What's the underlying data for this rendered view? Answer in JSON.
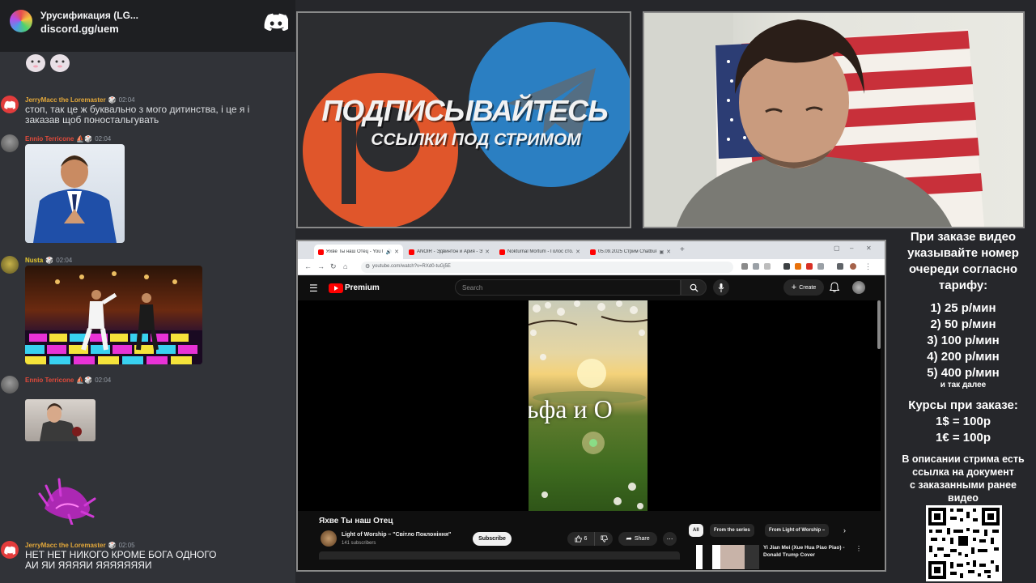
{
  "discord": {
    "server_name": "Урусификация (LG...",
    "invite": "discord.gg/uem",
    "messages": [
      {
        "author": "JerryMacc the Loremaster",
        "time": "02:04",
        "text_lines": [
          "стоп, так це ж буквально з мого дитинства, і це я і",
          "заказав щоб поностальгувать"
        ]
      },
      {
        "author": "Ennio Terricone",
        "time": "02:04",
        "attachment": "suit-man-image"
      },
      {
        "author": "Nusta",
        "time": "02:04",
        "attachment": "disco-dance-image"
      },
      {
        "author": "Ennio Terricone",
        "time": "02:04",
        "attachment": "man-photo"
      },
      {
        "author": "JerryMacc the Loremaster",
        "time": "02:05",
        "text_lines": [
          "НЕТ НЕТ НИКОГО КРОМЕ БОГА ОДНОГО",
          "АИ ЯИ ЯЯЯЯИ ЯЯЯЯЯЯЯИ"
        ]
      }
    ]
  },
  "promo": {
    "title": "ПОДПИСЫВАЙТЕСЬ",
    "subtitle": "ССЫЛКИ ПОД СТРИМОМ"
  },
  "browser": {
    "tabs": [
      {
        "title": "Яхве Ты наш Отец - YouTube",
        "active": true,
        "favicon_color": "#ff0000"
      },
      {
        "title": "ANOIR - Эдвинтон и Ария - Эд...",
        "active": false,
        "favicon_color": "#ff0000"
      },
      {
        "title": "Nokturnal Mortum - Голос сто...",
        "active": false,
        "favicon_color": "#ff0000"
      },
      {
        "title": "05.09.2025 Стрим Chatbukit ...",
        "active": false,
        "favicon_color": "#ff0000"
      }
    ],
    "url": "youtube.com/watch?v=RXd0-tuGj5E"
  },
  "youtube": {
    "brand": "Premium",
    "search_placeholder": "Search",
    "create_label": "Create",
    "video_overlay_text": "льфа и О",
    "video_title": "Яхве Ты наш Отец",
    "channel_name": "Light of Worship – \"Світло Поклоніння\"",
    "subscribers": "141 subscribers",
    "subscribe_label": "Subscribe",
    "likes": "6",
    "share_label": "Share",
    "chips": [
      "All",
      "From the series",
      "From Light of Worship –"
    ],
    "recommended_title": "Yi Jian Mei (Xue Hua Piao Piao) - Donald Trump Cover"
  },
  "info_panel": {
    "heading_lines": [
      "При заказе видео",
      "указывайте номер",
      "очереди согласно",
      "тарифу:"
    ],
    "tariffs": [
      "1) 25 р/мин",
      "2) 50 р/мин",
      "3) 100 р/мин",
      "4) 200 р/мин",
      "5) 400 р/мин"
    ],
    "tariff_note": "и так далее",
    "rates_heading": "Курсы при заказе:",
    "rates": [
      "1$ = 100р",
      "1€ = 100р"
    ],
    "footer_lines": [
      "В описании стрима есть",
      "ссылка на документ",
      "с заказанными ранее",
      "видео"
    ]
  },
  "colors": {
    "discord_bg": "#313338",
    "youtube_red": "#ff0000",
    "telegram_blue": "#2b7fc2",
    "patreon_orange": "#e0562b"
  }
}
